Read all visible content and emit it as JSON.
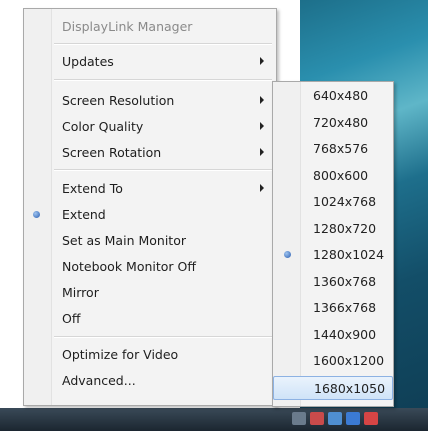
{
  "menu": {
    "title": "DisplayLink Manager",
    "updates": "Updates",
    "screen_resolution": "Screen Resolution",
    "color_quality": "Color Quality",
    "screen_rotation": "Screen Rotation",
    "extend_to": "Extend To",
    "extend": "Extend",
    "set_as_main_monitor": "Set as Main Monitor",
    "notebook_monitor_off": "Notebook Monitor Off",
    "mirror": "Mirror",
    "off": "Off",
    "optimize_for_video": "Optimize for Video",
    "advanced": "Advanced..."
  },
  "submenu": {
    "resolutions": [
      "640x480",
      "720x480",
      "768x576",
      "800x600",
      "1024x768",
      "1280x720",
      "1280x1024",
      "1360x768",
      "1366x768",
      "1440x900",
      "1600x1200",
      "1680x1050"
    ],
    "selected": "1280x1024",
    "highlighted": "1680x1050"
  },
  "colors": {
    "selection_dot": "#2a5db0",
    "highlight": "#cfe3f8"
  }
}
